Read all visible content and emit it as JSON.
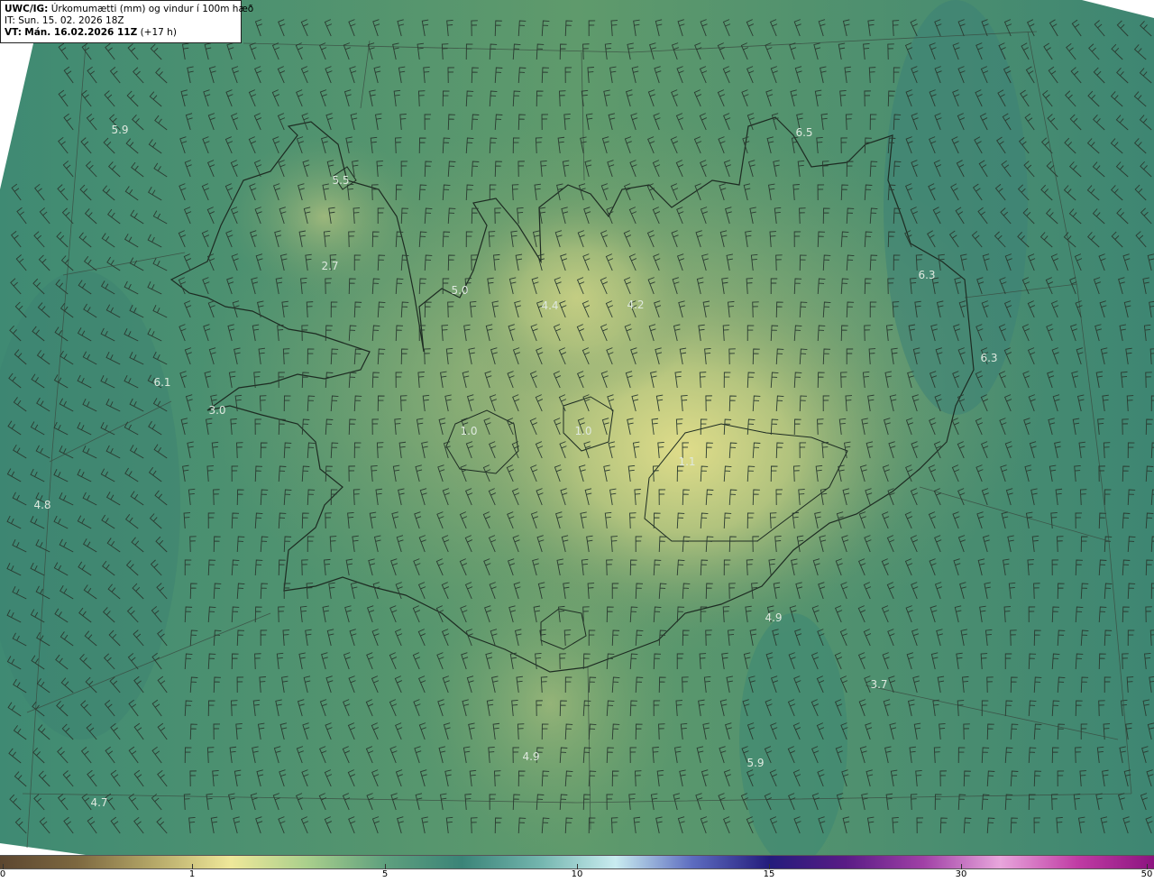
{
  "header": {
    "product": "UWC/IG:",
    "description": "Úrkomumætti (mm) og vindur í 100m hæð",
    "issue_time": "IT: Sun. 15. 02. 2026 18Z",
    "valid_label": "VT:",
    "valid_time": "Mán. 16.02.2026 11Z",
    "lead_time": "(+17 h)"
  },
  "map_labels": [
    {
      "text": "5.9"
    },
    {
      "text": "6.5"
    },
    {
      "text": "5.5"
    },
    {
      "text": "2.7"
    },
    {
      "text": "5.0"
    },
    {
      "text": "4.4"
    },
    {
      "text": "4.2"
    },
    {
      "text": "6.3"
    },
    {
      "text": "6.3"
    },
    {
      "text": "6.1"
    },
    {
      "text": "3.0"
    },
    {
      "text": "4.8"
    },
    {
      "text": "1.0"
    },
    {
      "text": "1.0"
    },
    {
      "text": "1.1"
    },
    {
      "text": "4.9"
    },
    {
      "text": "3.7"
    },
    {
      "text": "4.9"
    },
    {
      "text": "5.9"
    },
    {
      "text": "4.7"
    }
  ],
  "colorbar": {
    "ticks": [
      "0",
      "1",
      "5",
      "10",
      "15",
      "30",
      "50"
    ],
    "colors": [
      "#5c4630",
      "#7d6840",
      "#b5a868",
      "#efe89a",
      "#a9cf8c",
      "#5fa07e",
      "#3b8478",
      "#72b4ad",
      "#c9ecf0",
      "#5d6cc0",
      "#241c7c",
      "#5a1c86",
      "#a040a6",
      "#e8a6dc",
      "#c03ca4",
      "#8c1480"
    ]
  }
}
